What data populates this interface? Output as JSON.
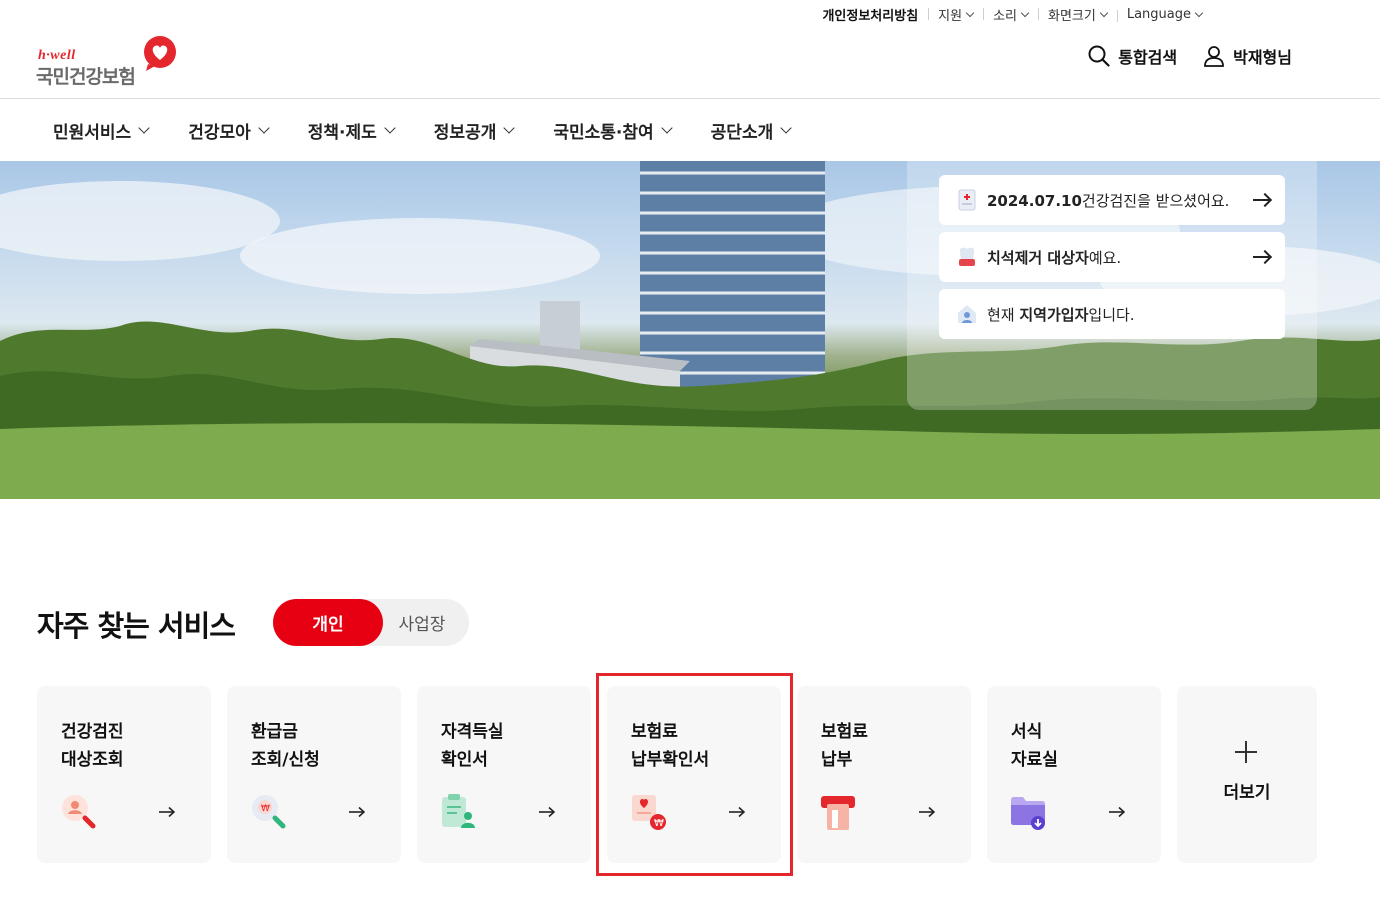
{
  "utility": {
    "items": [
      {
        "label": "개인정보처리방침",
        "dropdown": false
      },
      {
        "label": "지원",
        "dropdown": true
      },
      {
        "label": "소리",
        "dropdown": true
      },
      {
        "label": "화면크기",
        "dropdown": true
      },
      {
        "label": "Language",
        "dropdown": true
      }
    ]
  },
  "header": {
    "logo_tagline": "h·well",
    "logo_name": "국민건강보험",
    "search_label": "통합검색",
    "user_label": "박재형님"
  },
  "gnb": {
    "items": [
      "민원서비스",
      "건강모아",
      "정책·제도",
      "정보공개",
      "국민소통·참여",
      "공단소개"
    ]
  },
  "hero": {
    "notices": [
      {
        "bold": "2024.07.10",
        "text": "건강검진을 받으셨어요.",
        "icon": "checkup-document-icon"
      },
      {
        "bold": "치석제거 대상자",
        "text": "예요.",
        "icon": "tooth-icon"
      },
      {
        "prefix": "현재 ",
        "bold": "지역가입자",
        "text": "입니다.",
        "icon": "home-user-icon"
      }
    ]
  },
  "services": {
    "title": "자주 찾는 서비스",
    "toggle": {
      "active": "개인",
      "inactive": "사업장"
    },
    "cards": [
      {
        "label": "건강검진\n대상조회",
        "icon": "search-person-icon"
      },
      {
        "label": "환급금\n조회/신청",
        "icon": "search-refund-icon"
      },
      {
        "label": "자격득실\n확인서",
        "icon": "clipboard-person-icon"
      },
      {
        "label": "보험료\n납부확인서",
        "icon": "payment-certificate-icon"
      },
      {
        "label": "보험료\n납부",
        "icon": "payment-terminal-icon"
      },
      {
        "label": "서식\n자료실",
        "icon": "folder-download-icon"
      }
    ],
    "more_label": "더보기"
  },
  "colors": {
    "brand_red": "#e60012",
    "highlight": "#e4262d"
  }
}
